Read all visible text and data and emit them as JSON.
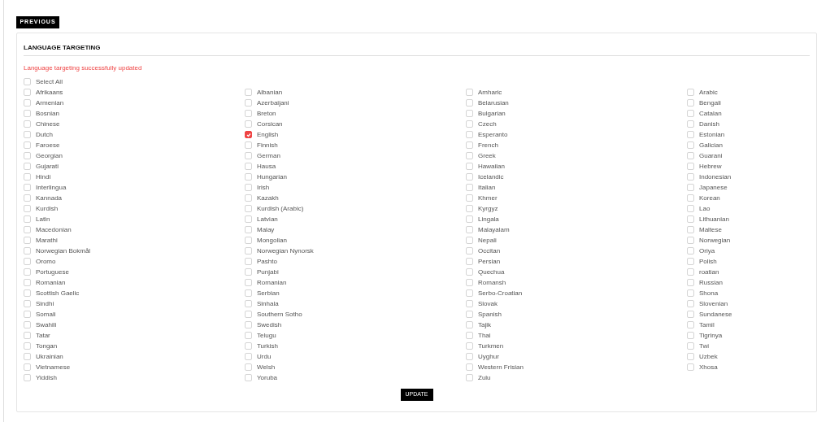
{
  "previous_button": "PREVIOUS",
  "section": {
    "title": "LANGUAGE TARGETING",
    "message": "Language targeting successfully updated",
    "select_all": {
      "label": "Select All",
      "checked": false
    },
    "columns": [
      [
        {
          "label": "Afrikaans",
          "checked": false
        },
        {
          "label": "Armenian",
          "checked": false
        },
        {
          "label": "Bosnian",
          "checked": false
        },
        {
          "label": "Chinese",
          "checked": false
        },
        {
          "label": "Dutch",
          "checked": false
        },
        {
          "label": "Faroese",
          "checked": false
        },
        {
          "label": "Georgian",
          "checked": false
        },
        {
          "label": "Gujarati",
          "checked": false
        },
        {
          "label": "Hindi",
          "checked": false
        },
        {
          "label": "Interlingua",
          "checked": false
        },
        {
          "label": "Kannada",
          "checked": false
        },
        {
          "label": "Kurdish",
          "checked": false
        },
        {
          "label": "Latin",
          "checked": false
        },
        {
          "label": "Macedonian",
          "checked": false
        },
        {
          "label": "Marathi",
          "checked": false
        },
        {
          "label": "Norwegian Bokmål",
          "checked": false
        },
        {
          "label": "Oromo",
          "checked": false
        },
        {
          "label": "Portuguese",
          "checked": false
        },
        {
          "label": "Romanian",
          "checked": false
        },
        {
          "label": "Scottish Gaelic",
          "checked": false
        },
        {
          "label": "Sindhi",
          "checked": false
        },
        {
          "label": "Somali",
          "checked": false
        },
        {
          "label": "Swahili",
          "checked": false
        },
        {
          "label": "Tatar",
          "checked": false
        },
        {
          "label": "Tongan",
          "checked": false
        },
        {
          "label": "Ukrainian",
          "checked": false
        },
        {
          "label": "Vietnamese",
          "checked": false
        },
        {
          "label": "Yiddish",
          "checked": false
        }
      ],
      [
        {
          "label": "Albanian",
          "checked": false
        },
        {
          "label": "Azerbaijani",
          "checked": false
        },
        {
          "label": "Breton",
          "checked": false
        },
        {
          "label": "Corsican",
          "checked": false
        },
        {
          "label": "English",
          "checked": true
        },
        {
          "label": "Finnish",
          "checked": false
        },
        {
          "label": "German",
          "checked": false
        },
        {
          "label": "Hausa",
          "checked": false
        },
        {
          "label": "Hungarian",
          "checked": false
        },
        {
          "label": "Irish",
          "checked": false
        },
        {
          "label": "Kazakh",
          "checked": false
        },
        {
          "label": "Kurdish (Arabic)",
          "checked": false
        },
        {
          "label": "Latvian",
          "checked": false
        },
        {
          "label": "Malay",
          "checked": false
        },
        {
          "label": "Mongolian",
          "checked": false
        },
        {
          "label": "Norwegian Nynorsk",
          "checked": false
        },
        {
          "label": "Pashto",
          "checked": false
        },
        {
          "label": "Punjabi",
          "checked": false
        },
        {
          "label": "Romanian",
          "checked": false
        },
        {
          "label": "Serbian",
          "checked": false
        },
        {
          "label": "Sinhala",
          "checked": false
        },
        {
          "label": "Southern Sotho",
          "checked": false
        },
        {
          "label": "Swedish",
          "checked": false
        },
        {
          "label": "Telugu",
          "checked": false
        },
        {
          "label": "Turkish",
          "checked": false
        },
        {
          "label": "Urdu",
          "checked": false
        },
        {
          "label": "Welsh",
          "checked": false
        },
        {
          "label": "Yoruba",
          "checked": false
        }
      ],
      [
        {
          "label": "Amharic",
          "checked": false
        },
        {
          "label": "Belarusian",
          "checked": false
        },
        {
          "label": "Bulgarian",
          "checked": false
        },
        {
          "label": "Czech",
          "checked": false
        },
        {
          "label": "Esperanto",
          "checked": false
        },
        {
          "label": "French",
          "checked": false
        },
        {
          "label": "Greek",
          "checked": false
        },
        {
          "label": "Hawaiian",
          "checked": false
        },
        {
          "label": "Icelandic",
          "checked": false
        },
        {
          "label": "Italian",
          "checked": false
        },
        {
          "label": "Khmer",
          "checked": false
        },
        {
          "label": "Kyrgyz",
          "checked": false
        },
        {
          "label": "Lingala",
          "checked": false
        },
        {
          "label": "Malayalam",
          "checked": false
        },
        {
          "label": "Nepali",
          "checked": false
        },
        {
          "label": "Occitan",
          "checked": false
        },
        {
          "label": "Persian",
          "checked": false
        },
        {
          "label": "Quechua",
          "checked": false
        },
        {
          "label": "Romansh",
          "checked": false
        },
        {
          "label": "Serbo-Croatian",
          "checked": false
        },
        {
          "label": "Slovak",
          "checked": false
        },
        {
          "label": "Spanish",
          "checked": false
        },
        {
          "label": "Tajik",
          "checked": false
        },
        {
          "label": "Thai",
          "checked": false
        },
        {
          "label": "Turkmen",
          "checked": false
        },
        {
          "label": "Uyghur",
          "checked": false
        },
        {
          "label": "Western Frisian",
          "checked": false
        },
        {
          "label": "Zulu",
          "checked": false
        }
      ],
      [
        {
          "label": "Arabic",
          "checked": false
        },
        {
          "label": "Bengali",
          "checked": false
        },
        {
          "label": "Catalan",
          "checked": false
        },
        {
          "label": "Danish",
          "checked": false
        },
        {
          "label": "Estonian",
          "checked": false
        },
        {
          "label": "Galician",
          "checked": false
        },
        {
          "label": "Guarani",
          "checked": false
        },
        {
          "label": "Hebrew",
          "checked": false
        },
        {
          "label": "Indonesian",
          "checked": false
        },
        {
          "label": "Japanese",
          "checked": false
        },
        {
          "label": "Korean",
          "checked": false
        },
        {
          "label": "Lao",
          "checked": false
        },
        {
          "label": "Lithuanian",
          "checked": false
        },
        {
          "label": "Maltese",
          "checked": false
        },
        {
          "label": "Norwegian",
          "checked": false
        },
        {
          "label": "Oriya",
          "checked": false
        },
        {
          "label": "Polish",
          "checked": false
        },
        {
          "label": "roatian",
          "checked": false
        },
        {
          "label": "Russian",
          "checked": false
        },
        {
          "label": "Shona",
          "checked": false
        },
        {
          "label": "Slovenian",
          "checked": false
        },
        {
          "label": "Sundanese",
          "checked": false
        },
        {
          "label": "Tamil",
          "checked": false
        },
        {
          "label": "Tigrinya",
          "checked": false
        },
        {
          "label": "Twi",
          "checked": false
        },
        {
          "label": "Uzbek",
          "checked": false
        },
        {
          "label": "Xhosa",
          "checked": false
        }
      ]
    ],
    "update_button": "UPDATE"
  }
}
